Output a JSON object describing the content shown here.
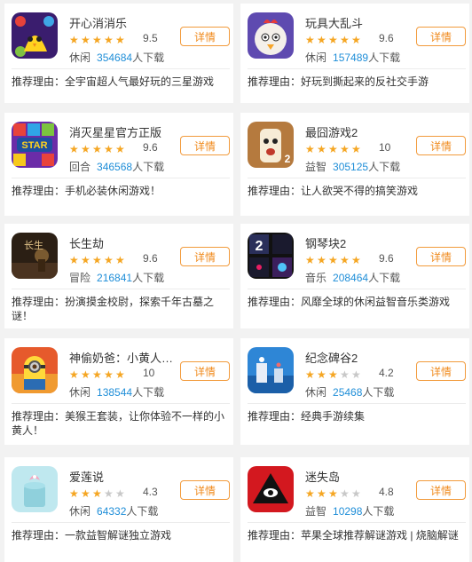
{
  "detail_label": "详情",
  "reason_prefix": "推荐理由：",
  "download_unit": "人下载",
  "games": [
    {
      "name": "开心消消乐",
      "rating": "9.5",
      "stars": 5,
      "category": "休闲",
      "downloads": "354684",
      "reason": "全宇宙超人气最好玩的三星游戏",
      "icon": "chick-icon"
    },
    {
      "name": "玩具大乱斗",
      "rating": "9.6",
      "stars": 5,
      "category": "休闲",
      "downloads": "157489",
      "reason": "好玩到撕起来的反社交手游",
      "icon": "chicken-toy-icon"
    },
    {
      "name": "消灭星星官方正版",
      "rating": "9.6",
      "stars": 5,
      "category": "回合",
      "downloads": "346568",
      "reason": "手机必装休闲游戏！",
      "icon": "pop-star-icon"
    },
    {
      "name": "最囧游戏2",
      "rating": "10",
      "stars": 5,
      "category": "益智",
      "downloads": "305125",
      "reason": "让人欲哭不得的搞笑游戏",
      "icon": "funny-face-icon"
    },
    {
      "name": "长生劫",
      "rating": "9.6",
      "stars": 5,
      "category": "冒险",
      "downloads": "216841",
      "reason": "扮演摸金校尉，探索千年古墓之谜！",
      "icon": "tomb-icon"
    },
    {
      "name": "钢琴块2",
      "rating": "9.6",
      "stars": 5,
      "category": "音乐",
      "downloads": "208464",
      "reason": "风靡全球的休闲益智音乐类游戏",
      "icon": "piano-tiles-icon"
    },
    {
      "name": "神偷奶爸：小黄人…",
      "rating": "10",
      "stars": 5,
      "category": "休闲",
      "downloads": "138544",
      "reason": "美猴王套装，让你体验不一样的小黄人！",
      "icon": "minion-icon"
    },
    {
      "name": "纪念碑谷2",
      "rating": "4.2",
      "stars": 3,
      "category": "休闲",
      "downloads": "25468",
      "reason": "经典手游续集",
      "icon": "monument-icon"
    },
    {
      "name": "爱莲说",
      "rating": "4.3",
      "stars": 3,
      "category": "休闲",
      "downloads": "64332",
      "reason": "一款益智解谜独立游戏",
      "icon": "lotus-cup-icon"
    },
    {
      "name": "迷失岛",
      "rating": "4.8",
      "stars": 3,
      "category": "益智",
      "downloads": "10298",
      "reason": "苹果全球推荐解谜游戏 | 烧脑解谜",
      "icon": "eye-triangle-icon"
    }
  ],
  "colors": {
    "accent": "#f08a1c",
    "star": "#f5a623",
    "count": "#1f8ed8"
  }
}
